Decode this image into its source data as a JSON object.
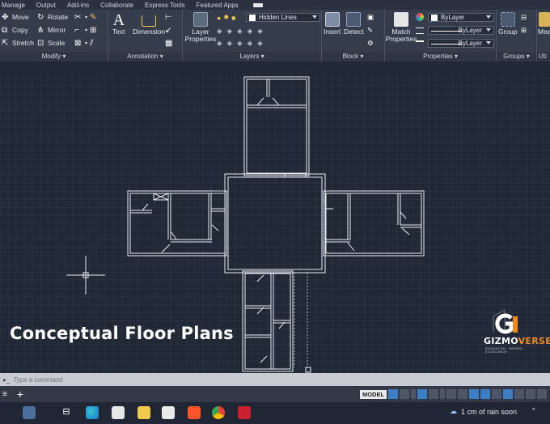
{
  "menubar": {
    "items": [
      "Manage",
      "Output",
      "Add-ins",
      "Collaborate",
      "Express Tools",
      "Featured Apps"
    ]
  },
  "ribbon": {
    "modify": {
      "label": "Modify",
      "move": "Move",
      "rotate": "Rotate",
      "copy": "Copy",
      "mirror": "Mirror",
      "stretch": "Stretch",
      "scale": "Scale"
    },
    "annotation": {
      "label": "Annotation",
      "text": "Text",
      "dimension": "Dimension"
    },
    "layers": {
      "label": "Layers",
      "layer_properties": "Layer\nProperties",
      "current_layer": "Hidden Lines"
    },
    "block": {
      "label": "Block",
      "insert": "Insert",
      "detect": "Detect"
    },
    "properties": {
      "label": "Properties",
      "match": "Match\nProperties",
      "color": "ByLayer",
      "linetype": "ByLayer",
      "lineweight": "ByLayer"
    },
    "groups": {
      "label": "Groups",
      "group": "Group"
    },
    "utilities": {
      "label": "Uti",
      "measure": "Mea"
    }
  },
  "overlay": {
    "title": "Conceptual Floor Plans",
    "logo_word_a": "GIZMO",
    "logo_word_b": "VERSE",
    "logo_tagline": "INNOVATION · DESIGN · EXCELLENCE"
  },
  "command": {
    "placeholder": "Type a command"
  },
  "status": {
    "model": "MODEL"
  },
  "weather": {
    "text": "1 cm of rain soon"
  },
  "colors": {
    "accent": "#3d7fc4",
    "brand_orange": "#f08a24",
    "autocad_red": "#c8202f"
  }
}
